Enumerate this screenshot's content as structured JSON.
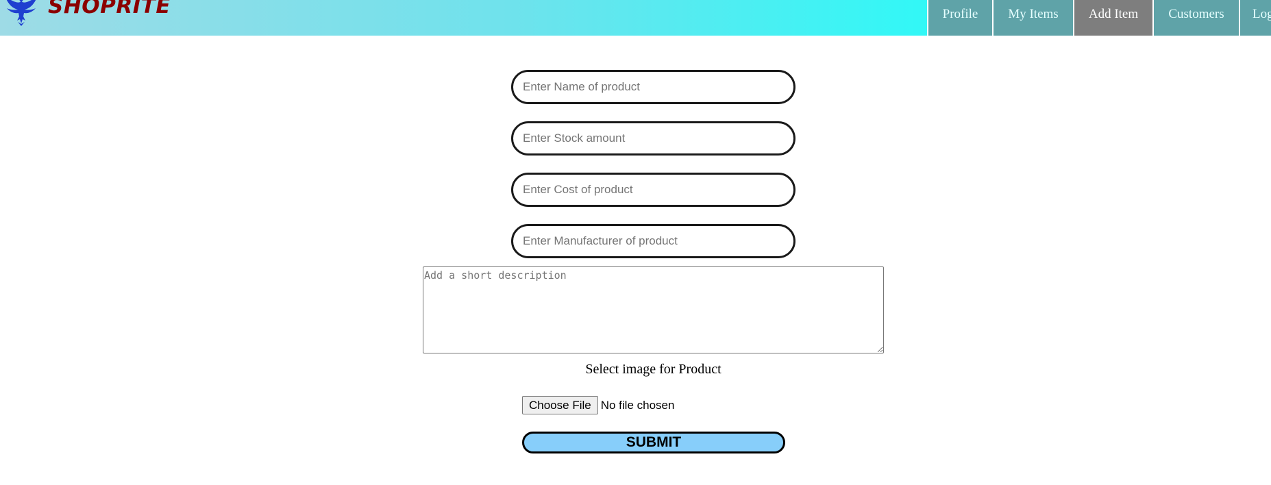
{
  "header": {
    "brand": "SHOPRITE",
    "logo_icon": "eagle-logo-icon",
    "gradient_colors": [
      "#9edbe6",
      "#33f7f6",
      "#20fdfd"
    ],
    "brand_color": "#8b0000"
  },
  "nav": {
    "items": [
      {
        "label": "Profile",
        "active": false
      },
      {
        "label": "My Items",
        "active": false
      },
      {
        "label": "Add Item",
        "active": true
      },
      {
        "label": "Customers",
        "active": false
      },
      {
        "label": "Log",
        "active": false
      }
    ],
    "item_color": "#5fa3a8",
    "active_color": "#7e7e7e"
  },
  "form": {
    "name_placeholder": "Enter Name of product",
    "stock_placeholder": "Enter Stock amount",
    "cost_placeholder": "Enter Cost of product",
    "manufacturer_placeholder": "Enter Manufacturer of product",
    "description_placeholder": "Add a short description",
    "image_label": "Select image for Product",
    "choose_file_label": "Choose File",
    "file_status": "No file chosen",
    "submit_label": "SUBMIT",
    "submit_color": "#87cefa"
  }
}
